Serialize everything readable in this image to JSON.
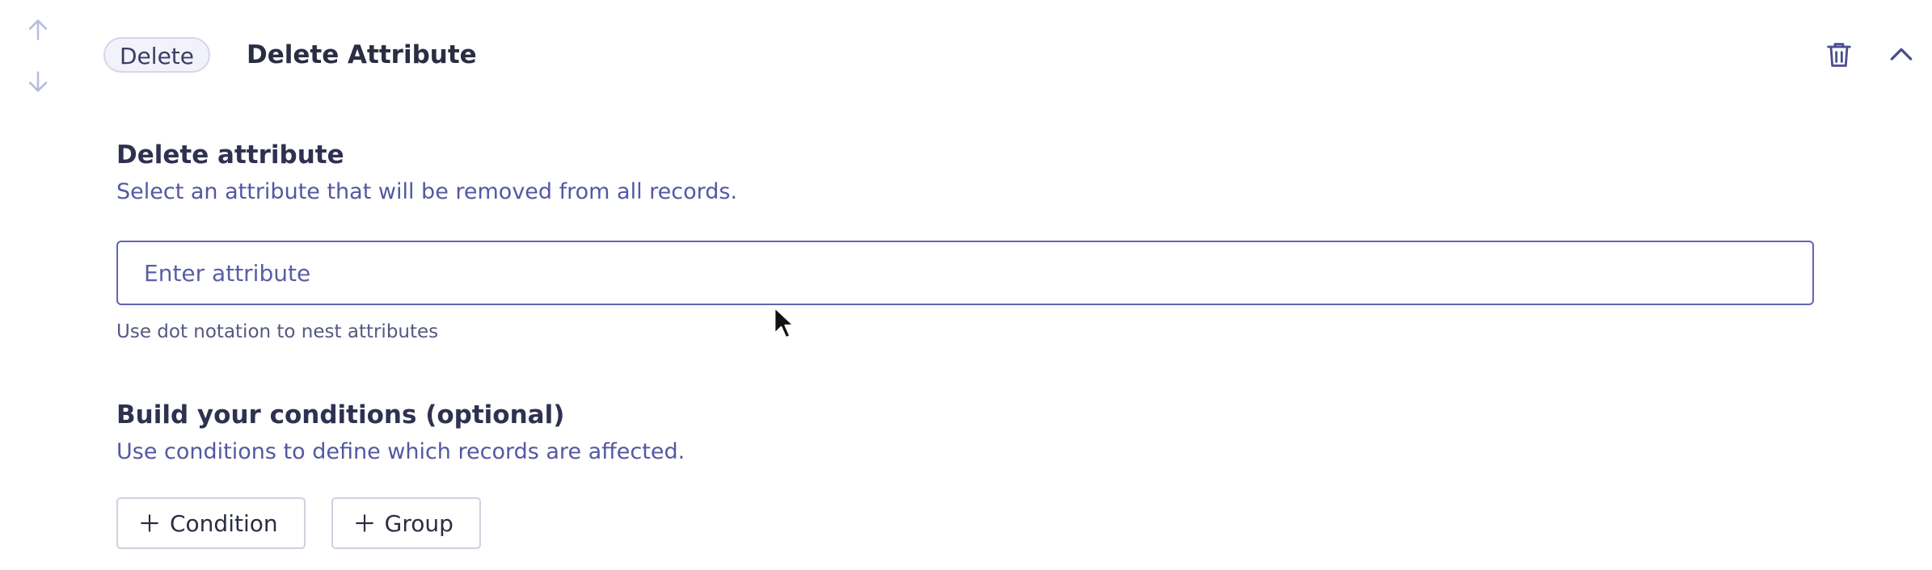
{
  "reorder": {
    "up_icon": "arrow-up-icon",
    "down_icon": "arrow-down-icon"
  },
  "header": {
    "step_type": "Delete",
    "step_title": "Delete Attribute",
    "delete_icon": "trash-icon",
    "collapse_icon": "chevron-up-icon"
  },
  "attribute_section": {
    "title": "Delete attribute",
    "description": "Select an attribute that will be removed from all records.",
    "input_value": "",
    "input_placeholder": "Enter attribute",
    "help_text": "Use dot notation to nest attributes"
  },
  "conditions_section": {
    "title": "Build your conditions (optional)",
    "description": "Use conditions to define which records are affected.",
    "add_condition_label": "Condition",
    "add_group_label": "Group",
    "plus_icon": "plus-icon"
  },
  "colors": {
    "accent": "#6165b5",
    "muted_text": "#5358a3",
    "arrow": "#b9bbdc",
    "pill_bg": "#f1f2fa"
  }
}
